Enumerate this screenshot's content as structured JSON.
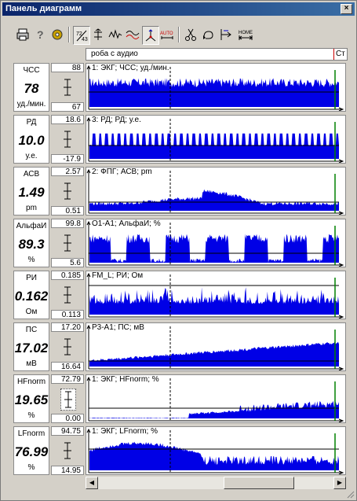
{
  "window": {
    "title": "Панель диаграмм",
    "close_label": "×"
  },
  "toolbar": {
    "buttons": [
      {
        "name": "print-icon"
      },
      {
        "name": "help-icon"
      },
      {
        "name": "settings-icon"
      },
      {
        "name": "scale-icon"
      },
      {
        "name": "align-icon"
      },
      {
        "name": "wave-icon"
      },
      {
        "name": "overlay-icon"
      },
      {
        "name": "axes-icon"
      },
      {
        "name": "auto-scale-icon",
        "label": "AUTO"
      },
      {
        "name": "scissors-icon"
      },
      {
        "name": "undo-icon"
      },
      {
        "name": "home-icon"
      },
      {
        "name": "home-range-icon",
        "label": "HOME"
      }
    ]
  },
  "addr": {
    "left_text": "роба с аудио",
    "right_text": "Ст"
  },
  "channels": [
    {
      "name": "ЧСС",
      "value": "78",
      "unit": "уд./мин.",
      "max": "88",
      "min": "67",
      "caption": "1: ЭКГ; ЧСС; уд./мин."
    },
    {
      "name": "РД",
      "value": "10.0",
      "unit": "у.е.",
      "max": "18.6",
      "min": "-17.9",
      "caption": "3: РД; РД; у.е."
    },
    {
      "name": "АСВ",
      "value": "1.49",
      "unit": "pm",
      "max": "2.57",
      "min": "0.51",
      "caption": "2: ФПГ; АСВ; pm"
    },
    {
      "name": "АльфаИ",
      "value": "89.3",
      "unit": "%",
      "max": "99.8",
      "min": "5.6",
      "caption": "O1-A1; АльфаИ; %"
    },
    {
      "name": "РИ",
      "value": "0.162",
      "unit": "Ом",
      "max": "0.185",
      "min": "0.113",
      "caption": "FM_L; РИ; Ом"
    },
    {
      "name": "ПС",
      "value": "17.02",
      "unit": "мВ",
      "max": "17.20",
      "min": "16.64",
      "caption": "P3-A1; ПС; мВ"
    },
    {
      "name": "HFnorm",
      "value": "19.65",
      "unit": "%",
      "max": "72.79",
      "min": "0.00",
      "caption": "1: ЭКГ; HFnorm; %"
    },
    {
      "name": "LFnorm",
      "value": "76.99",
      "unit": "%",
      "max": "94.75",
      "min": "14.95",
      "caption": "1: ЭКГ; LFnorm; %"
    }
  ],
  "colors": {
    "signal": "#0000e6",
    "marker": "#000000",
    "cursor": "#008000",
    "title_start": "#0a246a",
    "title_end": "#3a6ea5"
  },
  "scrollbar": {
    "left": "◀",
    "right": "▶"
  }
}
